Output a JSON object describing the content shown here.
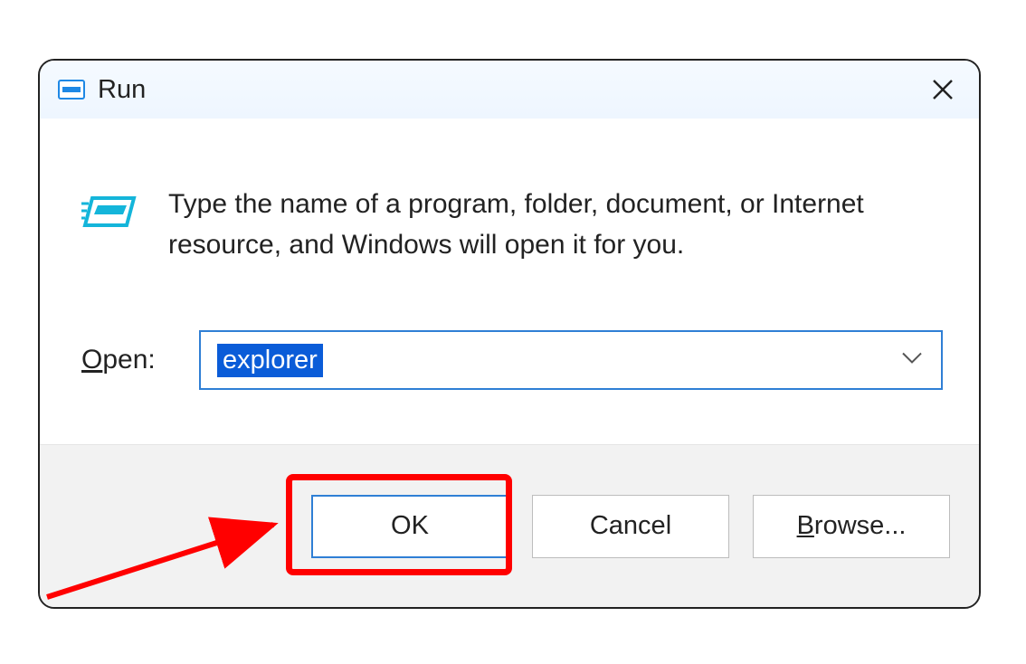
{
  "dialog": {
    "title": "Run",
    "description": "Type the name of a program, folder, document, or Internet resource, and Windows will open it for you.",
    "open_label_prefix": "O",
    "open_label_rest": "pen:",
    "input_value": "explorer",
    "buttons": {
      "ok": "OK",
      "cancel": "Cancel",
      "browse_prefix": "B",
      "browse_rest": "rowse..."
    }
  }
}
